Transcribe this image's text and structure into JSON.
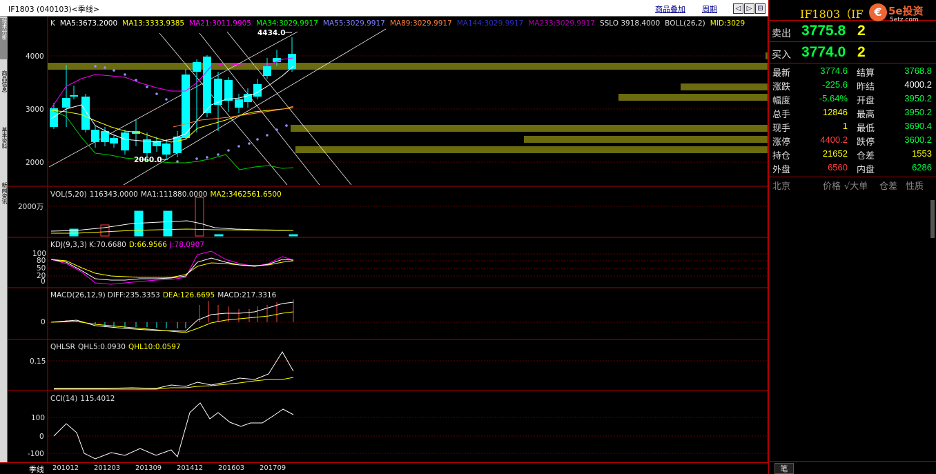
{
  "title_bar": {
    "symbol": "IF1803 (040103)",
    "period_label": "<季线>",
    "overlay_link": "商品叠加",
    "cycle_link": "周期",
    "nav_buttons": [
      "◁",
      "▷",
      "⊟"
    ]
  },
  "left_tabs": [
    "技术分析",
    "商品信息",
    "基本资料",
    "新闻资讯"
  ],
  "main_chart": {
    "indicators": [
      {
        "label": "K",
        "color": "#e0e0e0"
      },
      {
        "label": "MA5:3673.2000",
        "color": "#ffffff"
      },
      {
        "label": "MA13:3333.9385",
        "color": "#ffff00"
      },
      {
        "label": "MA21:3011.9905",
        "color": "#ff00ff"
      },
      {
        "label": "MA34:3029.9917",
        "color": "#00ff00"
      },
      {
        "label": "MA55:3029.9917",
        "color": "#8080ff"
      },
      {
        "label": "MA89:3029.9917",
        "color": "#ff8040"
      },
      {
        "label": "MA144:3029.9917",
        "color": "#3030c0"
      },
      {
        "label": "MA233:3029.9917",
        "color": "#b000b0"
      },
      {
        "label": "SSLO  3918.4000",
        "color": "#e0e0e0"
      },
      {
        "label": "BOLL(26,2)",
        "color": "#e0e0e0"
      },
      {
        "label": "MID:3029",
        "color": "#ffff00"
      }
    ],
    "y_ticks": [
      "4000",
      "3000",
      "2000"
    ],
    "high_marker": "4434.0",
    "low_marker": "2060.0"
  },
  "vol_panel": {
    "label": "VOL(5,20)",
    "value": "116343.0000",
    "ma1": "MA1:111880.0000",
    "ma2": "MA2:3462561.6500",
    "tick": "2000万"
  },
  "kdj_panel": {
    "label": "KDJ(9,3,3)",
    "k": "K:70.6680",
    "d": "D:66.9566",
    "j": "J:78.0907",
    "ticks": [
      "100",
      "80",
      "50",
      "20",
      "0"
    ]
  },
  "macd_panel": {
    "label": "MACD(26,12,9)",
    "diff": "DIFF:235.3353",
    "dea": "DEA:126.6695",
    "macd": "MACD:217.3316",
    "tick": "0"
  },
  "qhlsr_panel": {
    "label": "QHLSR",
    "qhl5": "QHL5:0.0930",
    "qhl10": "QHL10:0.0597",
    "tick": "0.15"
  },
  "cci_panel": {
    "label": "CCI(14)",
    "value": "115.4012",
    "ticks": [
      "100",
      "0",
      "-100"
    ]
  },
  "date_axis": {
    "period": "季线",
    "dates": [
      "201012",
      "201203",
      "201309",
      "201412",
      "201603",
      "201709"
    ]
  },
  "quote_panel": {
    "code": "IF1803（IF",
    "logo_brand": "5e投资",
    "logo_url": "5etz.com",
    "sell": {
      "label": "卖出",
      "price": "3775.8",
      "qty": "2"
    },
    "buy": {
      "label": "买入",
      "price": "3774.0",
      "qty": "2"
    },
    "rows": [
      {
        "k": "最新",
        "v": "3774.6",
        "vc": "cg",
        "k2": "结算",
        "v2": "3768.8",
        "v2c": "cg"
      },
      {
        "k": "涨跌",
        "v": "-225.6",
        "vc": "cg",
        "k2": "昨结",
        "v2": "4000.2",
        "v2c": "cw"
      },
      {
        "k": "幅度",
        "v": "-5.64%",
        "vc": "cg",
        "k2": "开盘",
        "v2": "3950.2",
        "v2c": "cg"
      },
      {
        "k": "总手",
        "v": "12846",
        "vc": "cy",
        "k2": "最高",
        "v2": "3950.2",
        "v2c": "cg"
      },
      {
        "k": "现手",
        "v": "1",
        "vc": "cy",
        "k2": "最低",
        "v2": "3690.4",
        "v2c": "cg"
      },
      {
        "k": "涨停",
        "v": "4400.2",
        "vc": "cr",
        "k2": "跌停",
        "v2": "3600.2",
        "v2c": "cg"
      },
      {
        "k": "持仓",
        "v": "21652",
        "vc": "cy",
        "k2": "仓差",
        "v2": "1553",
        "v2c": "cy"
      },
      {
        "k": "外盘",
        "v": "6560",
        "vc": "cr",
        "k2": "内盘",
        "v2": "6286",
        "v2c": "cg"
      }
    ],
    "ticker_headers": [
      "北京",
      "价格",
      "√大单",
      "仓差",
      "性质"
    ],
    "footer_tab": "笔"
  },
  "colors": {
    "up": "#ff4040",
    "down": "#00ffff",
    "panel_border": "#b00000",
    "band": "#6b6b10"
  }
}
